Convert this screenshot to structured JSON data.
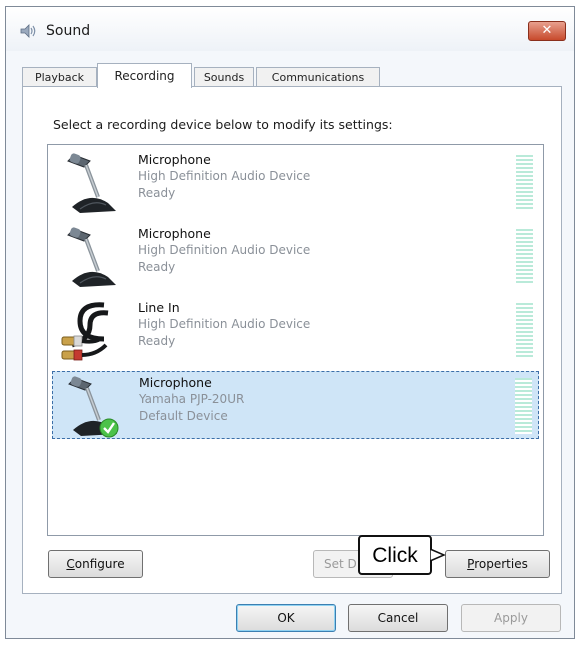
{
  "window": {
    "title": "Sound",
    "close_label": "✕",
    "close_color": "#c74a2c"
  },
  "tabs": [
    {
      "label": "Playback",
      "active": false
    },
    {
      "label": "Recording",
      "active": true
    },
    {
      "label": "Sounds",
      "active": false
    },
    {
      "label": "Communications",
      "active": false
    }
  ],
  "instruction": "Select a recording device below to modify its settings:",
  "devices": [
    {
      "name": "Microphone",
      "description": "High Definition Audio Device",
      "status": "Ready",
      "icon": "microphone-icon",
      "selected": false
    },
    {
      "name": "Microphone",
      "description": "High Definition Audio Device",
      "status": "Ready",
      "icon": "microphone-icon",
      "selected": false
    },
    {
      "name": "Line In",
      "description": "High Definition Audio Device",
      "status": "Ready",
      "icon": "line-in-cable-icon",
      "selected": false
    },
    {
      "name": "Microphone",
      "description": "Yamaha PJP-20UR",
      "status": "Default Device",
      "icon": "microphone-icon",
      "selected": true,
      "badge": "default-check-icon"
    }
  ],
  "buttons": {
    "configure": {
      "prefix": "",
      "accel": "C",
      "rest": "onfigure"
    },
    "set_default": "Set D",
    "properties": {
      "prefix": "",
      "accel": "P",
      "rest": "roperties"
    },
    "ok": "OK",
    "cancel": "Cancel",
    "apply": "Apply"
  },
  "callout": {
    "text": "Click"
  },
  "colors": {
    "selection": "#cfe5f7",
    "level_meter": "#b9ead9",
    "status_text": "#8a9098"
  }
}
